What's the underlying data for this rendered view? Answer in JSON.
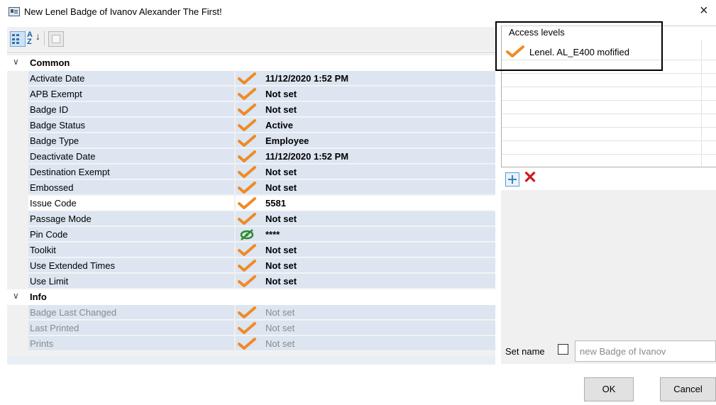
{
  "window": {
    "title": "New Lenel Badge of Ivanov Alexander The First!",
    "close_glyph": "×"
  },
  "toolbar": {
    "alpha_label": "2↓",
    "alpha_top": "A",
    "alpha_bottom": "Z"
  },
  "categories": [
    {
      "name": "Common",
      "chevron": "∨",
      "properties": [
        {
          "name": "Activate Date",
          "value": "11/12/2020 1:52 PM",
          "icon": "check-icon"
        },
        {
          "name": "APB Exempt",
          "value": "Not set",
          "icon": "check-icon"
        },
        {
          "name": "Badge ID",
          "value": "Not set",
          "icon": "check-icon"
        },
        {
          "name": "Badge Status",
          "value": "Active",
          "icon": "check-icon"
        },
        {
          "name": "Badge Type",
          "value": "Employee",
          "icon": "check-icon"
        },
        {
          "name": "Deactivate Date",
          "value": "11/12/2020 1:52 PM",
          "icon": "check-icon"
        },
        {
          "name": "Destination Exempt",
          "value": "Not set",
          "icon": "check-icon"
        },
        {
          "name": "Embossed",
          "value": "Not set",
          "icon": "check-icon"
        },
        {
          "name": "Issue Code",
          "value": "5581",
          "icon": "check-icon"
        },
        {
          "name": "Passage Mode",
          "value": "Not set",
          "icon": "check-icon"
        },
        {
          "name": "Pin Code",
          "value": "****",
          "icon": "hidden-eye-icon"
        },
        {
          "name": "Toolkit",
          "value": "Not set",
          "icon": "check-icon"
        },
        {
          "name": "Use Extended Times",
          "value": "Not set",
          "icon": "check-icon"
        },
        {
          "name": "Use Limit",
          "value": "Not set",
          "icon": "check-icon"
        }
      ]
    },
    {
      "name": "Info",
      "chevron": "∨",
      "properties": [
        {
          "name": "Badge Last Changed",
          "value": "Not set",
          "icon": "check-icon"
        },
        {
          "name": "Last Printed",
          "value": "Not set",
          "icon": "check-icon"
        },
        {
          "name": "Prints",
          "value": "Not set",
          "icon": "check-icon"
        }
      ]
    }
  ],
  "access_levels": {
    "header": "Access levels",
    "items": [
      {
        "label": "Lenel. AL_E400 mofified",
        "icon": "check-icon"
      }
    ]
  },
  "set_name": {
    "label": "Set name",
    "checked": false,
    "value": "new Badge of Ivanov"
  },
  "buttons": {
    "ok": "OK",
    "cancel": "Cancel"
  },
  "colors": {
    "check": "#f08a24",
    "eye": "#2e8b2e",
    "delete": "#d01a1a",
    "grid_row": "#dce5f0"
  }
}
